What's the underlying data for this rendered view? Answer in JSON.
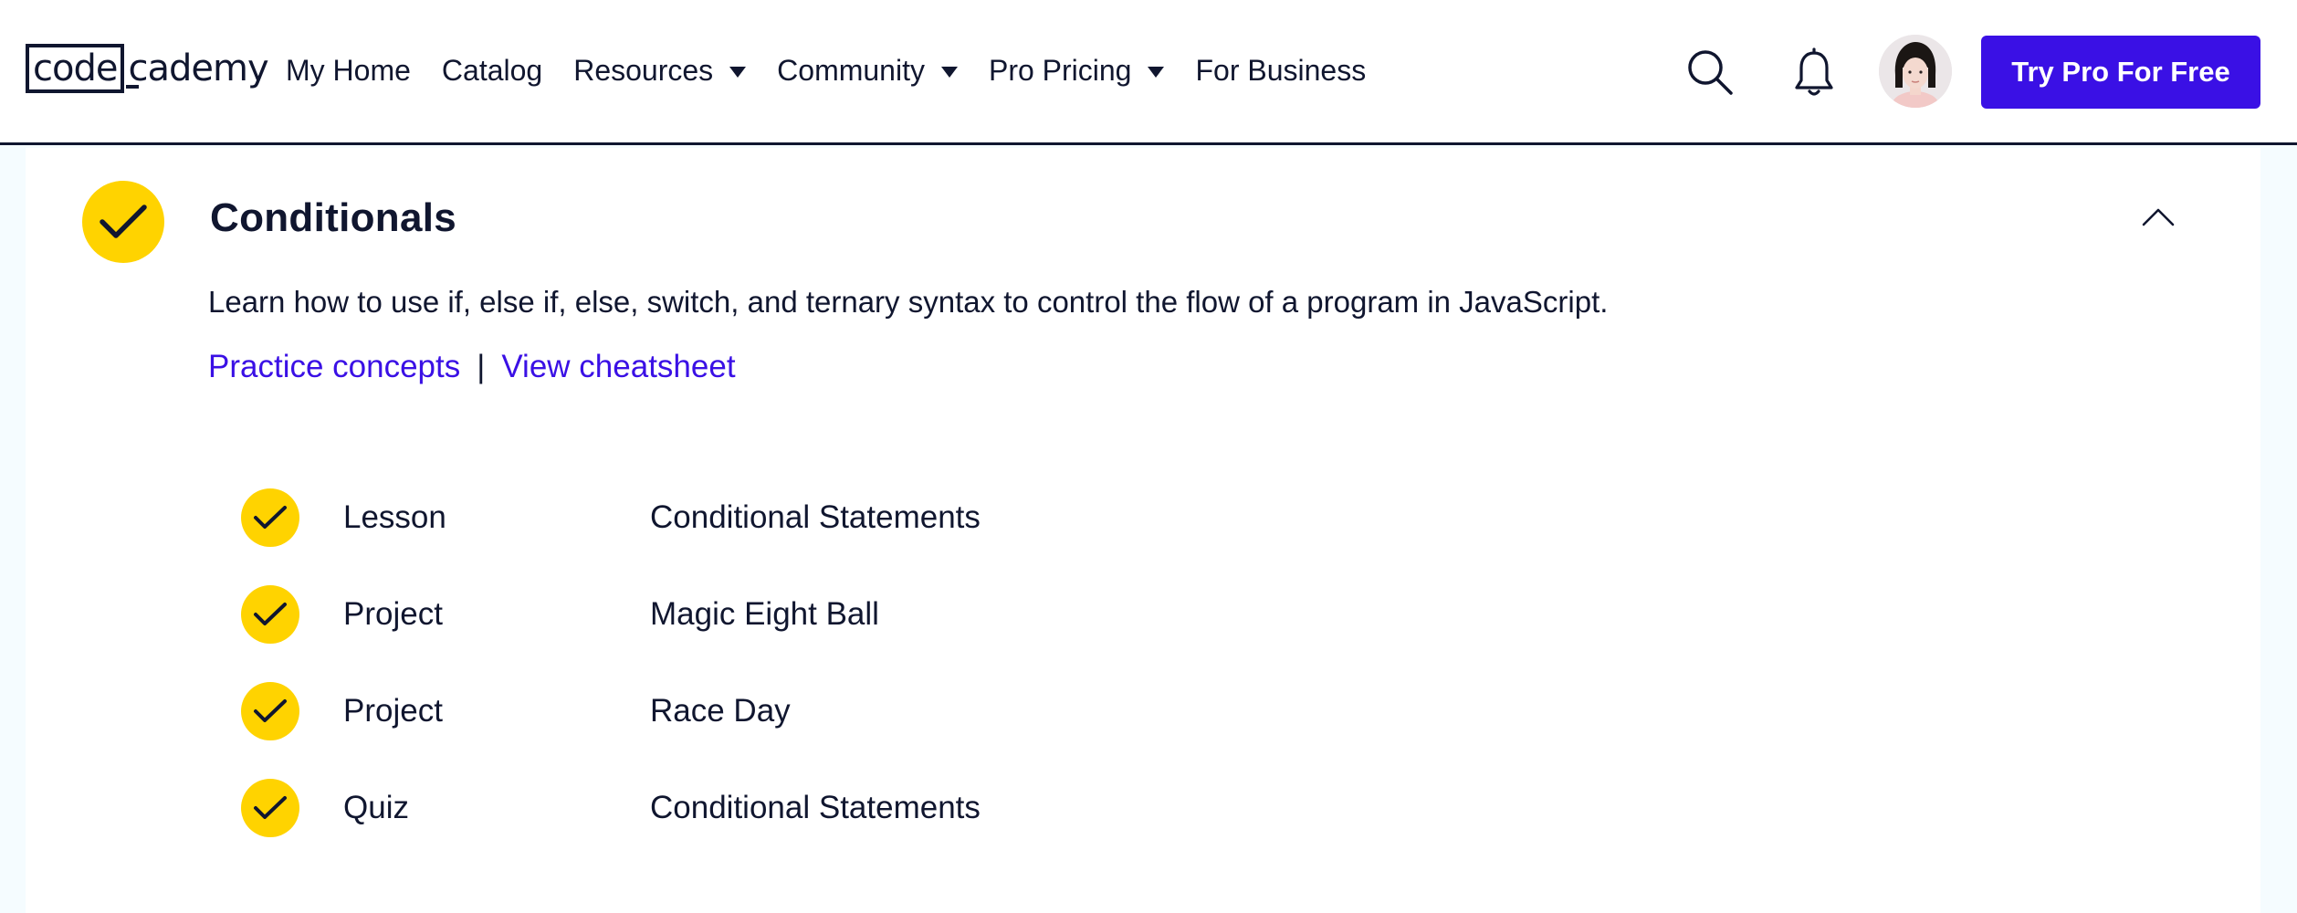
{
  "logo": {
    "part1": "code",
    "part2": "cademy"
  },
  "nav": {
    "items": [
      {
        "label": "My Home",
        "dropdown": false
      },
      {
        "label": "Catalog",
        "dropdown": false
      },
      {
        "label": "Resources",
        "dropdown": true
      },
      {
        "label": "Community",
        "dropdown": true
      },
      {
        "label": "Pro Pricing",
        "dropdown": true
      },
      {
        "label": "For Business",
        "dropdown": false
      }
    ]
  },
  "header": {
    "icons": [
      "search-icon",
      "bell-icon"
    ],
    "cta_label": "Try Pro For Free"
  },
  "module": {
    "title": "Conditionals",
    "completed": true,
    "expanded": true,
    "description": "Learn how to use if, else if, else, switch, and ternary syntax to control the flow of a program in JavaScript.",
    "links": {
      "practice": "Practice concepts",
      "separator": "|",
      "cheatsheet": "View cheatsheet"
    },
    "items": [
      {
        "type": "Lesson",
        "name": "Conditional Statements",
        "completed": true
      },
      {
        "type": "Project",
        "name": "Magic Eight Ball",
        "completed": true
      },
      {
        "type": "Project",
        "name": "Race Day",
        "completed": true
      },
      {
        "type": "Quiz",
        "name": "Conditional Statements",
        "completed": true
      }
    ]
  },
  "colors": {
    "accent": "#3a10e5",
    "check_fill": "#ffd300",
    "text": "#10162f",
    "page_bg": "#f5fcff"
  }
}
